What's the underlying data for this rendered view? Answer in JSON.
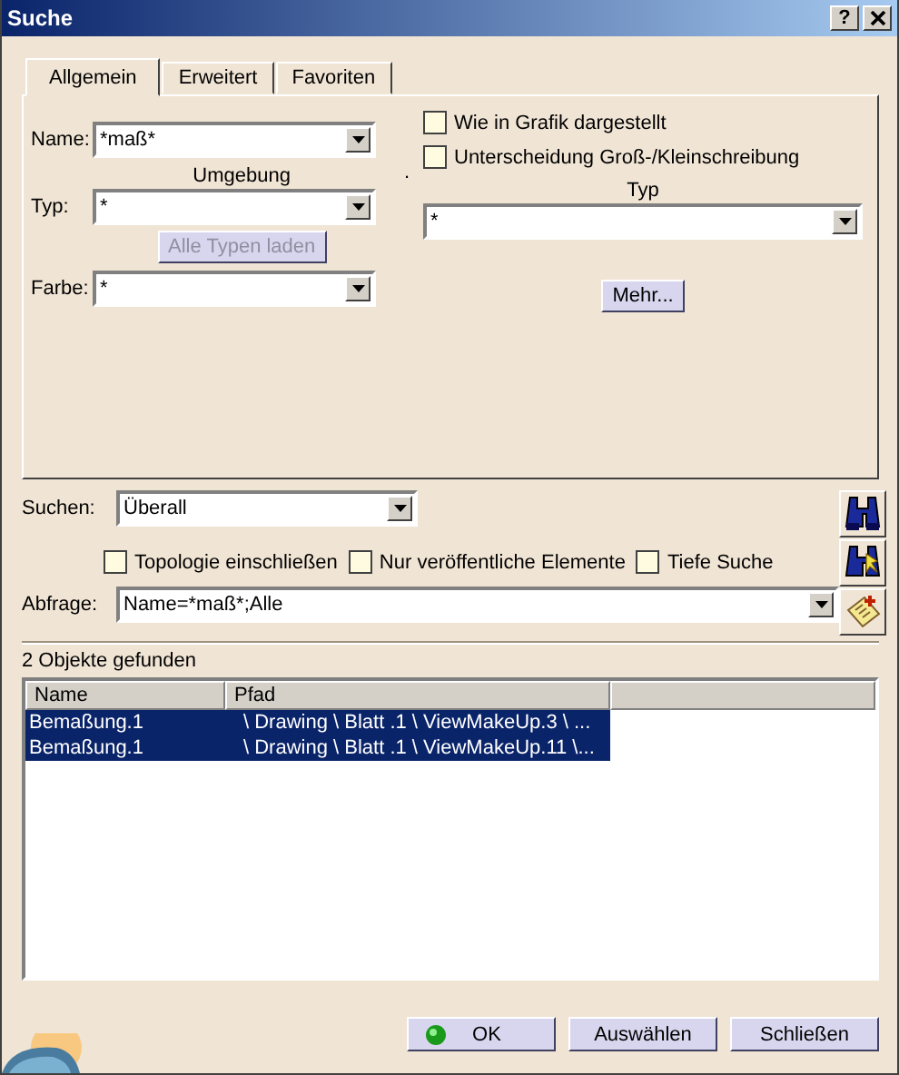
{
  "window": {
    "title": "Suche",
    "help": "?"
  },
  "tabs": [
    {
      "label": "Allgemein",
      "selected": true
    },
    {
      "label": "Erweitert",
      "selected": false
    },
    {
      "label": "Favoriten",
      "selected": false
    }
  ],
  "general": {
    "name": {
      "label": "Name:",
      "value": "*maß*"
    },
    "checkboxes": [
      {
        "label": "Wie in Grafik dargestellt",
        "checked": false
      },
      {
        "label": "Unterscheidung Groß-/Kleinschreibung",
        "checked": false
      }
    ],
    "environment_heading": "Umgebung",
    "separator_mark": ".",
    "type_heading": "Typ",
    "type": {
      "label": "Typ:",
      "value": "*"
    },
    "type_right": {
      "value": "*"
    },
    "load_button": {
      "label": "Alle Typen laden",
      "disabled": true
    },
    "color": {
      "label": "Farbe:",
      "value": "*"
    },
    "more_button": "Mehr..."
  },
  "search": {
    "label": "Suchen:",
    "value": "Überall"
  },
  "options": [
    {
      "label": "Topologie einschließen",
      "checked": false
    },
    {
      "label": "Nur veröffentliche Elemente",
      "checked": false
    },
    {
      "label": "Tiefe Suche",
      "checked": false
    }
  ],
  "query": {
    "label": "Abfrage:",
    "value": "Name=*maß*;Alle"
  },
  "result_count": "2 Objekte gefunden",
  "table": {
    "columns": [
      "Name",
      "Pfad"
    ],
    "rows": [
      {
        "name": "Bemaßung.1",
        "path": "\\ Drawing \\ Blatt .1 \\ ViewMakeUp.3 \\ ...",
        "selected": true
      },
      {
        "name": "Bemaßung.1",
        "path": "\\ Drawing \\ Blatt .1 \\ ViewMakeUp.11 \\...",
        "selected": true
      }
    ]
  },
  "buttons": [
    {
      "label": "OK",
      "kind": "ok"
    },
    {
      "label": "Auswählen",
      "kind": "plain"
    },
    {
      "label": "Schließen",
      "kind": "plain"
    }
  ]
}
